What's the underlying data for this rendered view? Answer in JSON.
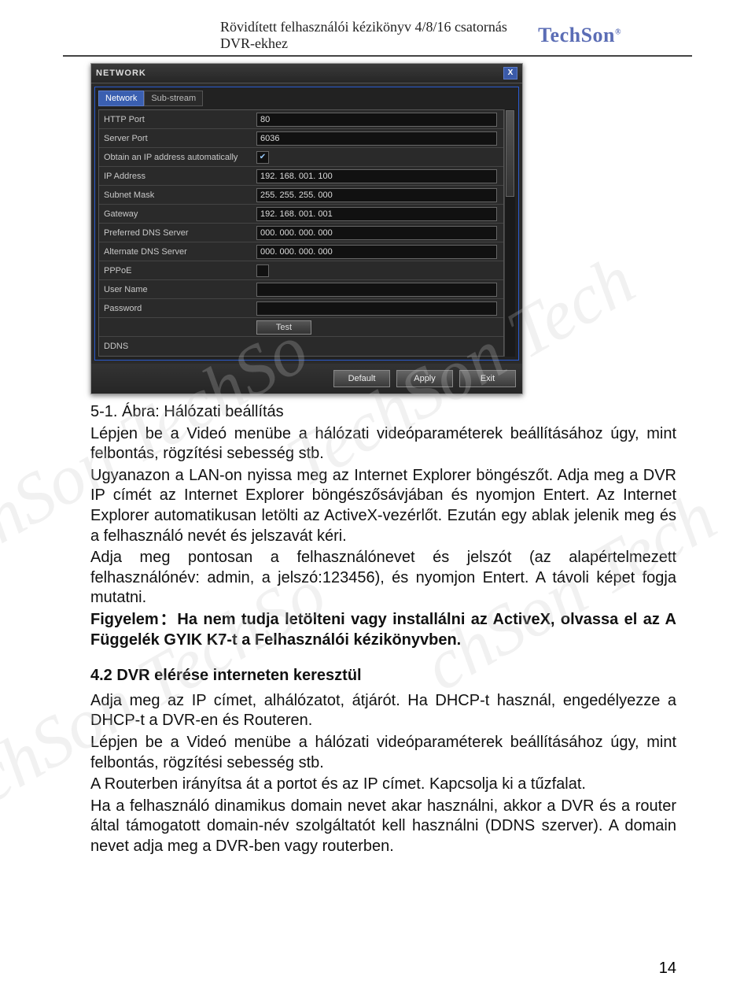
{
  "header": {
    "title": "Rövidített felhasználói kézikönyv 4/8/16 csatornás DVR-ekhez",
    "logo": "TechSon",
    "logo_r": "®"
  },
  "dialog": {
    "title": "NETWORK",
    "close": "X",
    "tabs": {
      "network": "Network",
      "substream": "Sub-stream"
    },
    "fields": {
      "http_port": {
        "label": "HTTP Port",
        "value": "80"
      },
      "server_port": {
        "label": "Server Port",
        "value": "6036"
      },
      "obtain_ip": {
        "label": "Obtain an IP address automatically",
        "checked": "✔"
      },
      "ip_address": {
        "label": "IP Address",
        "value": "192. 168. 001. 100"
      },
      "subnet_mask": {
        "label": "Subnet Mask",
        "value": "255. 255. 255. 000"
      },
      "gateway": {
        "label": "Gateway",
        "value": "192. 168. 001. 001"
      },
      "pref_dns": {
        "label": "Preferred DNS Server",
        "value": "000. 000. 000. 000"
      },
      "alt_dns": {
        "label": "Alternate DNS Server",
        "value": "000. 000. 000. 000"
      },
      "pppoe": {
        "label": "PPPoE",
        "checked": ""
      },
      "user_name": {
        "label": "User Name",
        "value": ""
      },
      "password": {
        "label": "Password",
        "value": ""
      },
      "test": {
        "label": "Test"
      },
      "ddns": {
        "label": "DDNS"
      }
    },
    "buttons": {
      "default": "Default",
      "apply": "Apply",
      "exit": "Exit"
    }
  },
  "body": {
    "caption": "5-1. Ábra: Hálózati beállítás",
    "p1": "Lépjen be a Videó menübe a hálózati videóparaméterek beállításához úgy, mint felbontás, rögzítési sebesség stb.",
    "p2": "Ugyanazon a LAN-on nyissa meg az Internet Explorer böngészőt. Adja meg a DVR IP címét az Internet Explorer böngészősávjában és nyomjon Entert. Az Internet Explorer automatikusan letölti az ActiveX-vezérlőt. Ezután egy ablak jelenik meg és a felhasználó nevét és jelszavát kéri.",
    "p3": "Adja meg pontosan a felhasználónevet és jelszót (az alapértelmezett felhasználónév: admin, a jelszó:123456), és nyomjon Entert. A távoli képet fogja mutatni.",
    "p4": "Figyelem：Ha nem tudja letölteni vagy installálni az ActiveX, olvassa el az A Függelék GYIK K7-t a Felhasználói kézikönyvben.",
    "h2": "4.2  DVR elérése interneten keresztül",
    "p5": "Adja meg az IP címet, alhálózatot, átjárót. Ha DHCP-t használ, engedélyezze a DHCP-t a DVR-en és Routeren.",
    "p6": "Lépjen be a Videó menübe a hálózati videóparaméterek beállításához úgy, mint felbontás, rögzítési sebesség stb.",
    "p7": "A Routerben irányítsa át a portot és az IP címet. Kapcsolja ki a tűzfalat.",
    "p8": "Ha a felhasználó dinamikus domain nevet akar használni, akkor a DVR és a router által támogatott domain-név szolgáltatót kell használni (DDNS szerver). A domain nevet adja meg a DVR-ben vagy routerben."
  },
  "page_number": "14"
}
